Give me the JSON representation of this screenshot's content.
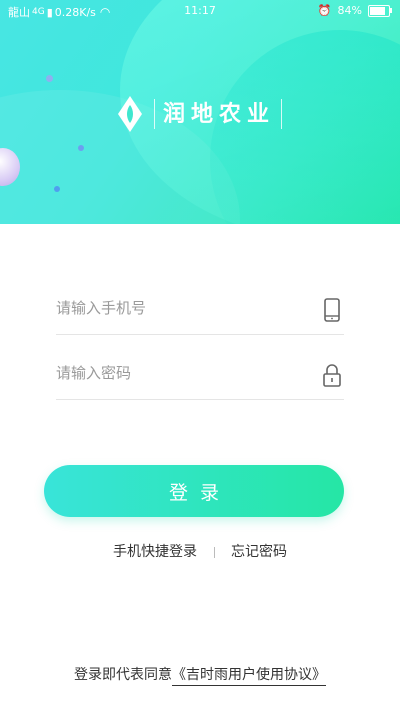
{
  "status_bar": {
    "carrier": "龍山",
    "network": "4G",
    "speed": "0.28K/s",
    "time": "11:17",
    "battery_percent": "84%",
    "battery_level": 0.84
  },
  "brand": {
    "name": "润地农业",
    "accent_start": "#39e4d9",
    "accent_end": "#25e6a5"
  },
  "form": {
    "phone_placeholder": "请输入手机号",
    "password_placeholder": "请输入密码",
    "login_label": "登录"
  },
  "links": {
    "quick_login": "手机快捷登录",
    "forgot_password": "忘记密码"
  },
  "agreement": {
    "prefix": "登录即代表同意",
    "link_text": "《吉时雨用户使用协议》"
  }
}
